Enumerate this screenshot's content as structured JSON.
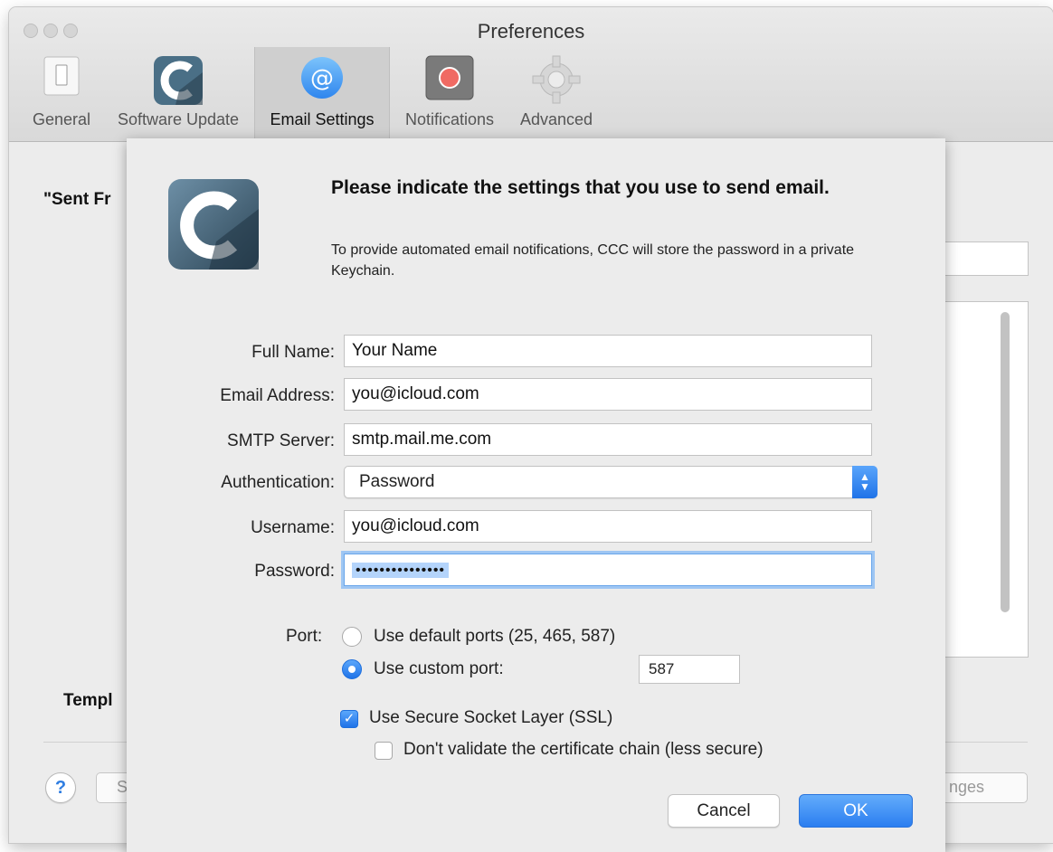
{
  "window": {
    "title": "Preferences"
  },
  "toolbar": {
    "tabs": [
      {
        "label": "General",
        "icon": "switch-icon"
      },
      {
        "label": "Software Update",
        "icon": "ccc-logo-icon"
      },
      {
        "label": "Email Settings",
        "icon": "at-sign-icon",
        "selected": true
      },
      {
        "label": "Notifications",
        "icon": "record-icon"
      },
      {
        "label": "Advanced",
        "icon": "gear-icon"
      }
    ]
  },
  "background": {
    "sent_from_label": "\"Sent Fr",
    "template_label": "Templ",
    "left_button_label": "S",
    "right_button_label": "nges",
    "help_label": "?"
  },
  "dialog": {
    "heading": "Please indicate the settings that you use to send email.",
    "description": "To provide automated email notifications, CCC will store the password in a private Keychain.",
    "fields": {
      "full_name": {
        "label": "Full Name:",
        "value": "Your Name"
      },
      "email": {
        "label": "Email Address:",
        "value": "you@icloud.com"
      },
      "smtp": {
        "label": "SMTP Server:",
        "value": "smtp.mail.me.com"
      },
      "auth": {
        "label": "Authentication:",
        "value": "Password"
      },
      "username": {
        "label": "Username:",
        "value": "you@icloud.com"
      },
      "password": {
        "label": "Password:",
        "value": "•••••••••••••••"
      }
    },
    "port": {
      "label": "Port:",
      "default_option": "Use default ports (25, 465, 587)",
      "custom_option": "Use custom port:",
      "custom_value": "587",
      "custom_selected": true
    },
    "ssl": {
      "label": "Use Secure Socket Layer (SSL)",
      "checked": true
    },
    "no_validate": {
      "label": "Don't validate the certificate chain (less secure)",
      "checked": false
    },
    "cancel_label": "Cancel",
    "ok_label": "OK",
    "colors": {
      "accent": "#2b7ef0",
      "selection": "#b4d4fb"
    }
  }
}
